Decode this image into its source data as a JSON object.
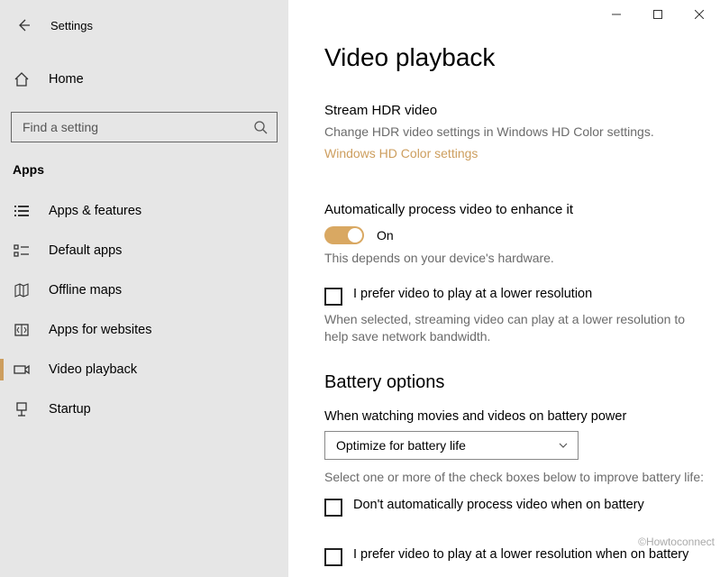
{
  "window": {
    "title": "Settings"
  },
  "sidebar": {
    "home_label": "Home",
    "search_placeholder": "Find a setting",
    "section_title": "Apps",
    "items": [
      {
        "label": "Apps & features"
      },
      {
        "label": "Default apps"
      },
      {
        "label": "Offline maps"
      },
      {
        "label": "Apps for websites"
      },
      {
        "label": "Video playback"
      },
      {
        "label": "Startup"
      }
    ]
  },
  "main": {
    "title": "Video playback",
    "hdr_section": {
      "heading": "Stream HDR video",
      "desc": "Change HDR video settings in Windows HD Color settings.",
      "link": "Windows HD Color settings"
    },
    "auto_section": {
      "heading": "Automatically process video to enhance it",
      "toggle_state": "On",
      "desc": "This depends on your device's hardware."
    },
    "lowres_check": {
      "label": "I prefer video to play at a lower resolution",
      "desc": "When selected, streaming video can play at a lower resolution to help save network bandwidth."
    },
    "battery": {
      "heading": "Battery options",
      "dropdown_label": "When watching movies and videos on battery power",
      "dropdown_value": "Optimize for battery life",
      "note": "Select one or more of the check boxes below to improve battery life:",
      "check1": "Don't automatically process video when on battery",
      "check2": "I prefer video to play at a lower resolution when on battery"
    }
  },
  "watermark": "©Howtoconnect"
}
